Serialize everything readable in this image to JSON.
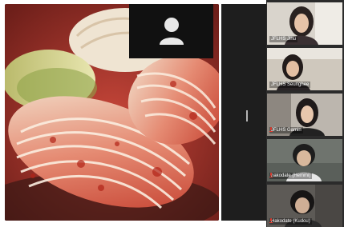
{
  "meeting": {
    "main_view": {
      "shared_content": "kimchi-photo",
      "camera_off_tile": {
        "icon": "person-icon"
      }
    },
    "participants": [
      {
        "name": "JFLHS Jihu",
        "mic": "unmuted",
        "speaking": false
      },
      {
        "name": "JFLHS Seunghee",
        "mic": "unmuted",
        "speaking": true
      },
      {
        "name": "JFLHS Gamin",
        "mic": "muted",
        "speaking": false
      },
      {
        "name": "hakodate (Hemmi)",
        "mic": "muted",
        "speaking": false
      },
      {
        "name": "Hakodate (Kudou)",
        "mic": "muted",
        "speaking": false
      }
    ]
  },
  "colors": {
    "active_speaker_border": "#f2ee6a",
    "muted_mic": "#e03a2e"
  }
}
